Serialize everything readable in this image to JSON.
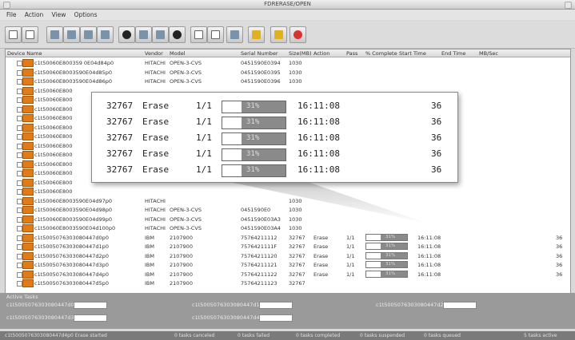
{
  "window": {
    "title": "FDRERASE/OPEN"
  },
  "menu": [
    "File",
    "Action",
    "View",
    "Options"
  ],
  "table": {
    "columns": [
      "Device Name",
      "Vendor",
      "Model",
      "Serial Number",
      "Size(MB)",
      "Action",
      "Pass",
      "% Complete",
      "Start Time",
      "End Time",
      "MB/Sec"
    ],
    "rows": [
      {
        "device": "c1t50060E800359 0E04d84p0",
        "vendor": "HITACHI",
        "model": "OPEN-3-CVS",
        "serial": "0451590E0394",
        "size": "1030",
        "action": "",
        "pass": "",
        "pct": "",
        "start": "",
        "mbs": ""
      },
      {
        "device": "c1t50060E8003590E04d85p0",
        "vendor": "HITACHI",
        "model": "OPEN-3-CVS",
        "serial": "0451590E0395",
        "size": "1030",
        "action": "",
        "pass": "",
        "pct": "",
        "start": "",
        "mbs": ""
      },
      {
        "device": "c1t50060E8003590E04d86p0",
        "vendor": "HITACHI",
        "model": "OPEN-3-CVS",
        "serial": "0451590E0396",
        "size": "1030",
        "action": "",
        "pass": "",
        "pct": "",
        "start": "",
        "mbs": ""
      },
      {
        "device": "c1t50060E800",
        "vendor": "",
        "model": "",
        "serial": "",
        "size": "",
        "action": "",
        "pass": "",
        "pct": "",
        "start": "",
        "mbs": ""
      },
      {
        "device": "c1t50060E800",
        "vendor": "",
        "model": "",
        "serial": "",
        "size": "",
        "action": "",
        "pass": "",
        "pct": "",
        "start": "",
        "mbs": ""
      },
      {
        "device": "c1t50060E800",
        "vendor": "",
        "model": "",
        "serial": "",
        "size": "",
        "action": "",
        "pass": "",
        "pct": "",
        "start": "",
        "mbs": ""
      },
      {
        "device": "c1t50060E800",
        "vendor": "",
        "model": "",
        "serial": "",
        "size": "",
        "action": "",
        "pass": "",
        "pct": "",
        "start": "",
        "mbs": ""
      },
      {
        "device": "c1t50060E800",
        "vendor": "",
        "model": "",
        "serial": "",
        "size": "",
        "action": "",
        "pass": "",
        "pct": "",
        "start": "",
        "mbs": ""
      },
      {
        "device": "c1t50060E800",
        "vendor": "",
        "model": "",
        "serial": "",
        "size": "",
        "action": "",
        "pass": "",
        "pct": "",
        "start": "",
        "mbs": ""
      },
      {
        "device": "c1t50060E800",
        "vendor": "",
        "model": "",
        "serial": "",
        "size": "",
        "action": "",
        "pass": "",
        "pct": "",
        "start": "",
        "mbs": ""
      },
      {
        "device": "c1t50060E800",
        "vendor": "",
        "model": "",
        "serial": "",
        "size": "",
        "action": "",
        "pass": "",
        "pct": "",
        "start": "",
        "mbs": ""
      },
      {
        "device": "c1t50060E800",
        "vendor": "",
        "model": "",
        "serial": "",
        "size": "",
        "action": "",
        "pass": "",
        "pct": "",
        "start": "",
        "mbs": ""
      },
      {
        "device": "c1t50060E800",
        "vendor": "",
        "model": "",
        "serial": "",
        "size": "",
        "action": "",
        "pass": "",
        "pct": "",
        "start": "",
        "mbs": ""
      },
      {
        "device": "c1t50060E800",
        "vendor": "",
        "model": "",
        "serial": "",
        "size": "",
        "action": "",
        "pass": "",
        "pct": "",
        "start": "",
        "mbs": ""
      },
      {
        "device": "c1t50060E800",
        "vendor": "",
        "model": "",
        "serial": "",
        "size": "",
        "action": "",
        "pass": "",
        "pct": "",
        "start": "",
        "mbs": ""
      },
      {
        "device": "c1t50060E8003590E04d97p0",
        "vendor": "HITACHI",
        "model": "",
        "serial": "",
        "size": "1030",
        "action": "",
        "pass": "",
        "pct": "",
        "start": "",
        "mbs": ""
      },
      {
        "device": "c1t50060E8003590E04d98p0",
        "vendor": "HITACHI",
        "model": "OPEN-3-CVS",
        "serial": "0451590E0",
        "size": "1030",
        "action": "",
        "pass": "",
        "pct": "",
        "start": "",
        "mbs": ""
      },
      {
        "device": "c1t50060E8003590E04d99p0",
        "vendor": "HITACHI",
        "model": "OPEN-3-CVS",
        "serial": "0451590E03A3",
        "size": "1030",
        "action": "",
        "pass": "",
        "pct": "",
        "start": "",
        "mbs": ""
      },
      {
        "device": "c1t50060E8003590E04d100p0",
        "vendor": "HITACHI",
        "model": "OPEN-3-CVS",
        "serial": "0451590E03A4",
        "size": "1030",
        "action": "",
        "pass": "",
        "pct": "",
        "start": "",
        "mbs": ""
      },
      {
        "device": "c1t5005076303080447d0p0",
        "vendor": "IBM",
        "model": "2107900",
        "serial": "75764211112",
        "size": "32767",
        "action": "Erase",
        "pass": "1/1",
        "pct": "31%",
        "start": "16:11:08",
        "mbs": "36"
      },
      {
        "device": "c1t5005076303080447d1p0",
        "vendor": "IBM",
        "model": "2107900",
        "serial": "7576421111F",
        "size": "32767",
        "action": "Erase",
        "pass": "1/1",
        "pct": "31%",
        "start": "16:11:08",
        "mbs": "36"
      },
      {
        "device": "c1t5005076303080447d2p0",
        "vendor": "IBM",
        "model": "2107900",
        "serial": "75764211120",
        "size": "32767",
        "action": "Erase",
        "pass": "1/1",
        "pct": "31%",
        "start": "16:11:08",
        "mbs": "36"
      },
      {
        "device": "c1t5005076303080447d3p0",
        "vendor": "IBM",
        "model": "2107900",
        "serial": "75764211121",
        "size": "32767",
        "action": "Erase",
        "pass": "1/1",
        "pct": "31%",
        "start": "16:11:08",
        "mbs": "36"
      },
      {
        "device": "c1t5005076303080447d4p0",
        "vendor": "IBM",
        "model": "2107900",
        "serial": "75764211122",
        "size": "32767",
        "action": "Erase",
        "pass": "1/1",
        "pct": "31%",
        "start": "16:11:08",
        "mbs": "36"
      },
      {
        "device": "c1t5005076303080447d5p0",
        "vendor": "IBM",
        "model": "2107900",
        "serial": "75764211123",
        "size": "32767",
        "action": "",
        "pass": "",
        "pct": "",
        "start": "",
        "mbs": ""
      }
    ]
  },
  "zoom_rows": [
    {
      "size": "32767",
      "action": "Erase",
      "pass": "1/1",
      "pct": "31%",
      "progress": 0.31,
      "start": "16:11:08",
      "mbs": "36"
    },
    {
      "size": "32767",
      "action": "Erase",
      "pass": "1/1",
      "pct": "31%",
      "progress": 0.31,
      "start": "16:11:08",
      "mbs": "36"
    },
    {
      "size": "32767",
      "action": "Erase",
      "pass": "1/1",
      "pct": "31%",
      "progress": 0.31,
      "start": "16:11:08",
      "mbs": "36"
    },
    {
      "size": "32767",
      "action": "Erase",
      "pass": "1/1",
      "pct": "31%",
      "progress": 0.31,
      "start": "16:11:08",
      "mbs": "36"
    },
    {
      "size": "32767",
      "action": "Erase",
      "pass": "1/1",
      "pct": "31%",
      "progress": 0.31,
      "start": "16:11:08",
      "mbs": "36"
    }
  ],
  "active_tasks": {
    "label": "Active Tasks",
    "tasks": [
      {
        "name": "c1t5005076303080447d0p0",
        "progress": 0.31
      },
      {
        "name": "c1t5005076303080447d1p0",
        "progress": 0.31
      },
      {
        "name": "c1t5005076303080447d2p0",
        "progress": 0.31
      },
      {
        "name": "c1t5005076303080447d3p0",
        "progress": 0.31
      },
      {
        "name": "c1t5005076303080447d4p0",
        "progress": 0.31
      }
    ]
  },
  "status_bar": [
    "c1t5005076303080447d4p0 Erase started",
    "0 tasks canceled",
    "0 tasks failed",
    "0 tasks completed",
    "0 tasks suspended",
    "0 tasks queued",
    "5 tasks active"
  ],
  "icons": [
    "grid-icon",
    "hierarchy-icon",
    "wand-icon",
    "wand-select-icon",
    "disk-icon",
    "drive-icon",
    "monitor-icon",
    "pause-icon",
    "play-icon",
    "stop-icon",
    "window-icon",
    "window-icon",
    "image-icon",
    "key-icon",
    "lock-icon",
    "power-icon"
  ],
  "colors": {
    "device_icon": "#e07b18",
    "progress_fill": "#8a8a8a",
    "status_bar": "#7a7a7a",
    "stop_button": "#d73333"
  }
}
